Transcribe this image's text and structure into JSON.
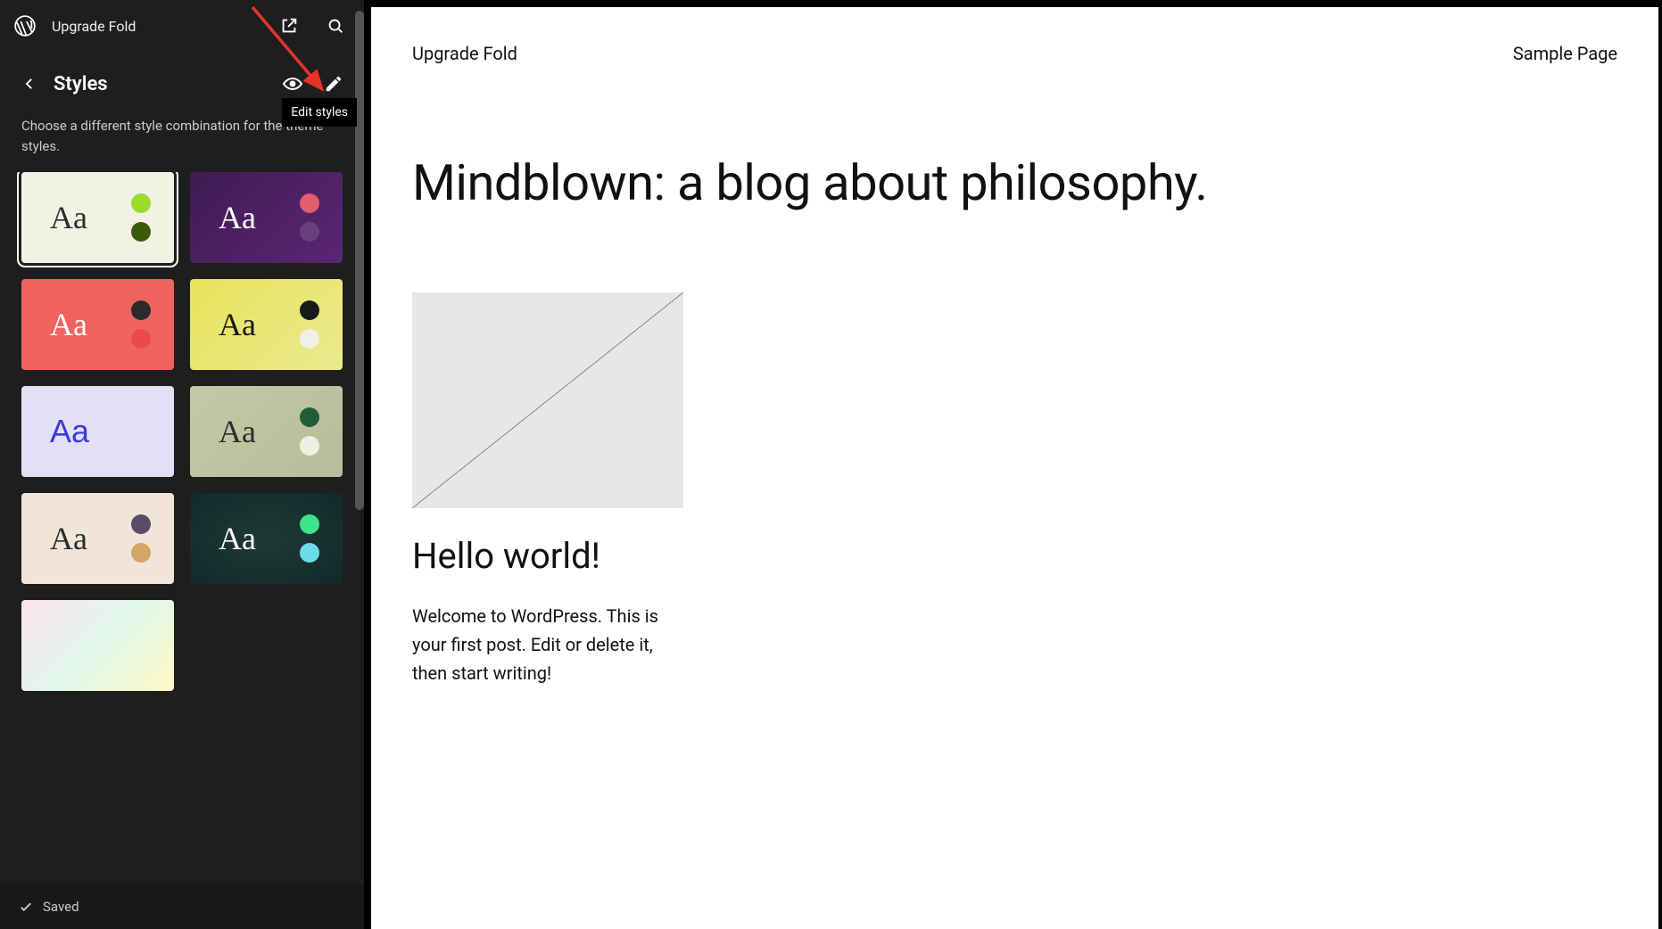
{
  "header": {
    "site_name": "Upgrade Fold"
  },
  "panel": {
    "title": "Styles",
    "description": "Choose a different style combination for the theme styles.",
    "tooltip": "Edit styles"
  },
  "footer": {
    "status": "Saved"
  },
  "styles": [
    {
      "label": "Aa",
      "bg": "bg-light",
      "selected": true,
      "dots": [
        "#9bdb2a",
        "#3a5a0e"
      ]
    },
    {
      "label": "Aa",
      "bg": "bg-purple",
      "selected": false,
      "dots": [
        "#e35d6a",
        "#6b3f7c"
      ]
    },
    {
      "label": "Aa",
      "bg": "bg-red",
      "selected": false,
      "dots": [
        "#2b2b2b",
        "#ea4b49"
      ]
    },
    {
      "label": "Aa",
      "bg": "bg-yellow",
      "selected": false,
      "dots": [
        "#1a1a1a",
        "#f0f0e6"
      ]
    },
    {
      "label": "Aa",
      "bg": "bg-lav",
      "selected": false,
      "dots": []
    },
    {
      "label": "Aa",
      "bg": "bg-sage",
      "selected": false,
      "dots": [
        "#1f5c3a",
        "#eef0e3"
      ]
    },
    {
      "label": "Aa",
      "bg": "bg-cream",
      "selected": false,
      "dots": [
        "#5a4b6b",
        "#d3a567"
      ]
    },
    {
      "label": "Aa",
      "bg": "bg-dark",
      "selected": false,
      "dots": [
        "#3de48a",
        "#6bdde8"
      ]
    },
    {
      "label": "",
      "bg": "bg-pastel",
      "selected": false,
      "dots": []
    }
  ],
  "preview": {
    "site_title": "Upgrade Fold",
    "nav_link": "Sample Page",
    "hero": "Mindblown: a blog about philosophy.",
    "post_title": "Hello world!",
    "post_body": "Welcome to WordPress. This is your first post. Edit or delete it, then start writing!"
  }
}
